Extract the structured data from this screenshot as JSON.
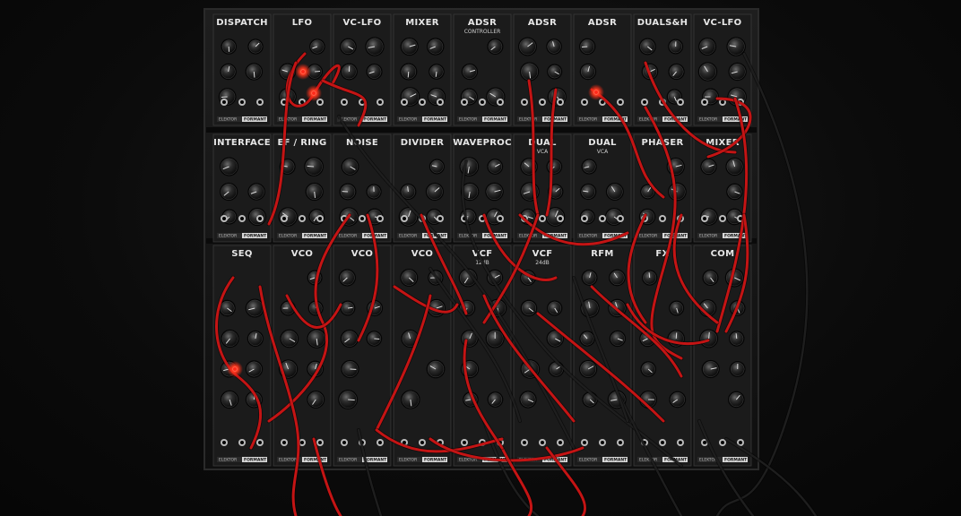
{
  "brand": {
    "left": "ELEKTOR",
    "right": "FORMANT"
  },
  "rows": [
    [
      {
        "title": "DISPATCH",
        "sub": ""
      },
      {
        "title": "LFO",
        "sub": ""
      },
      {
        "title": "VC-LFO",
        "sub": ""
      },
      {
        "title": "MIXER",
        "sub": ""
      },
      {
        "title": "ADSR",
        "sub": "CONTROLLER"
      },
      {
        "title": "ADSR",
        "sub": ""
      },
      {
        "title": "ADSR",
        "sub": ""
      },
      {
        "title": "DUALS&H",
        "sub": ""
      },
      {
        "title": "VC-LFO",
        "sub": ""
      }
    ],
    [
      {
        "title": "INTERFACE",
        "sub": ""
      },
      {
        "title": "EF / RING",
        "sub": ""
      },
      {
        "title": "NOISE",
        "sub": ""
      },
      {
        "title": "DIVIDER",
        "sub": ""
      },
      {
        "title": "WAVEPROC",
        "sub": ""
      },
      {
        "title": "DUAL",
        "sub": "VCA"
      },
      {
        "title": "DUAL",
        "sub": "VCA"
      },
      {
        "title": "PHASER",
        "sub": ""
      },
      {
        "title": "MIXER",
        "sub": ""
      }
    ],
    [
      {
        "title": "SEQ",
        "sub": ""
      },
      {
        "title": "VCO",
        "sub": ""
      },
      {
        "title": "VCO",
        "sub": ""
      },
      {
        "title": "VCO",
        "sub": ""
      },
      {
        "title": "VCF",
        "sub": "12dB"
      },
      {
        "title": "VCF",
        "sub": "24dB"
      },
      {
        "title": "RFM",
        "sub": ""
      },
      {
        "title": "FX",
        "sub": ""
      },
      {
        "title": "COM",
        "sub": ""
      }
    ]
  ],
  "colors": {
    "rack": "#141414",
    "panel": "#1b1b1b",
    "panel_edge": "#3a3a3a",
    "cable_red": "#c41414",
    "cable_black": "#1e1e1e",
    "led_red": "#ff2a1a"
  }
}
